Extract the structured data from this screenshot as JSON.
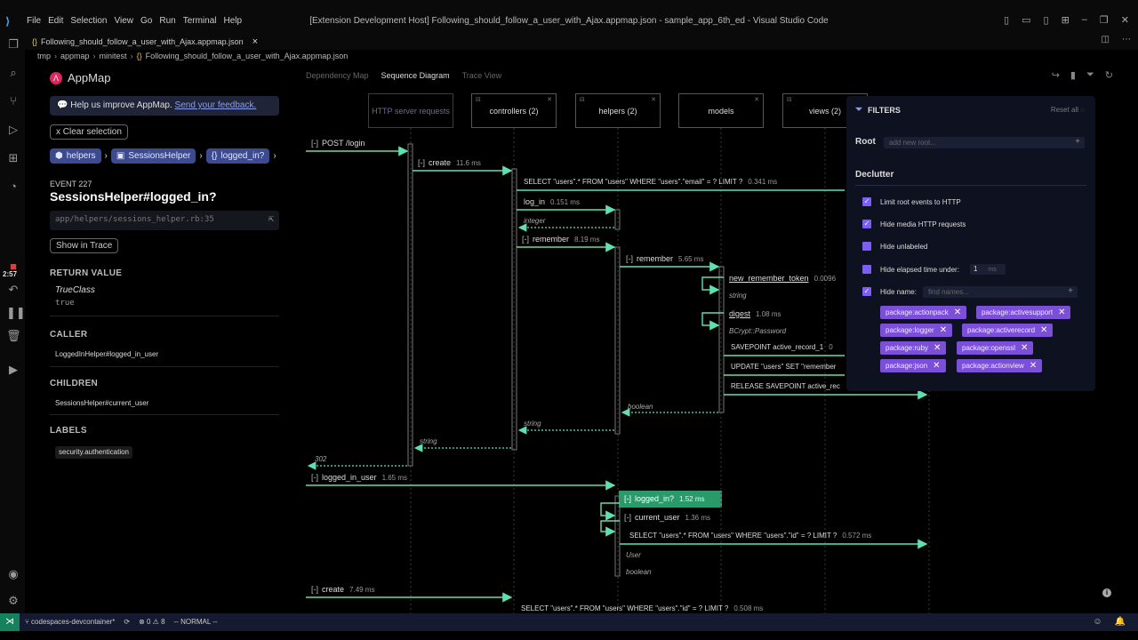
{
  "titlebar": {
    "menu": [
      "File",
      "Edit",
      "Selection",
      "View",
      "Go",
      "Run",
      "Terminal",
      "Help"
    ],
    "title": "[Extension Development Host] Following_should_follow_a_user_with_Ajax.appmap.json - sample_app_6th_ed - Visual Studio Code"
  },
  "tab": {
    "label": "Following_should_follow_a_user_with_Ajax.appmap.json",
    "icon": "json-braces-icon"
  },
  "breadcrumb": [
    "tmp",
    "appmap",
    "minitest",
    "Following_should_follow_a_user_with_Ajax.appmap.json"
  ],
  "activity": {
    "timer": "2:57"
  },
  "appmap": {
    "brand": "AppMap",
    "feedback_text": "Help us improve AppMap.",
    "feedback_link": "Send your feedback.",
    "clear_selection": "x  Clear selection",
    "crumbs": [
      "helpers",
      "SessionsHelper",
      "logged_in?"
    ],
    "event_label": "EVENT 227",
    "event_title": "SessionsHelper#logged_in?",
    "path": "app/helpers/sessions_helper.rb:35",
    "show_in_trace": "Show in Trace",
    "return_value_heading": "RETURN VALUE",
    "return_class": "TrueClass",
    "return_value": "true",
    "caller_heading": "CALLER",
    "caller": "LoggedInHelper#logged_in_user",
    "children_heading": "CHILDREN",
    "child": "SessionsHelper#current_user",
    "labels_heading": "LABELS",
    "label": "security.authentication"
  },
  "diagram": {
    "tabs": [
      "Dependency Map",
      "Sequence Diagram",
      "Trace View"
    ],
    "active_tab": "Sequence Diagram",
    "actors": [
      "HTTP server requests",
      "controllers (2)",
      "helpers (2)",
      "models",
      "views (2)"
    ],
    "messages": {
      "post_login": "POST /login",
      "create": "create",
      "create_ms": "11.6 ms",
      "sql_email": "SELECT \"users\".* FROM \"users\" WHERE \"users\".\"email\" = ? LIMIT ?",
      "sql_email_ms": "0.341 ms",
      "log_in": "log_in",
      "log_in_ms": "0.151 ms",
      "integer": "integer",
      "remember": "remember",
      "remember_ms": "8.19 ms",
      "remember2": "remember",
      "remember2_ms": "5.65 ms",
      "new_remember_token": "new_remember_token",
      "new_remember_token_ms": "0.0096",
      "string1": "string",
      "digest": "digest",
      "digest_ms": "1.08 ms",
      "bcrypt": "BCrypt::Password",
      "savepoint": "SAVEPOINT active_record_1",
      "savepoint_ms": "0",
      "update": "UPDATE \"users\" SET \"remember",
      "release": "RELEASE SAVEPOINT active_rec",
      "boolean1": "boolean",
      "string2": "string",
      "string3": "string",
      "r302": "302",
      "logged_in_user": "logged_in_user",
      "logged_in_user_ms": "1.65 ms",
      "logged_in": "logged_in?",
      "logged_in_ms": "1.52 ms",
      "current_user": "current_user",
      "current_user_ms": "1.36 ms",
      "sql_id": "SELECT \"users\".* FROM \"users\" WHERE \"users\".\"id\" = ? LIMIT ?",
      "sql_id_ms": "0.572 ms",
      "user": "User",
      "boolean2": "boolean",
      "create2": "create",
      "create2_ms": "7.49 ms",
      "sql_id2": "SELECT \"users\".* FROM \"users\" WHERE \"users\".\"id\" = ? LIMIT ?",
      "sql_id2_ms": "0.508 ms",
      "collapse": "[-]"
    }
  },
  "filters": {
    "title": "FILTERS",
    "reset": "Reset all",
    "root_label": "Root",
    "root_placeholder": "add new root...",
    "declutter_label": "Declutter",
    "options": [
      "Limit root events to HTTP",
      "Hide media HTTP requests",
      "Hide unlabeled",
      "Hide elapsed time under:",
      "Hide name:"
    ],
    "elapsed_value": "1",
    "elapsed_unit": "ms",
    "name_placeholder": "find names...",
    "packages": [
      "package:actionpack",
      "package:activesupport",
      "package:logger",
      "package:activerecord",
      "package:ruby",
      "package:openssl",
      "package:json",
      "package:actionview"
    ]
  },
  "status": {
    "remote": "codespaces-devcontainer*",
    "errors": "0",
    "warnings": "8",
    "mode": "-- NORMAL --"
  },
  "colors": {
    "arrow": "#5fe0b0",
    "accent": "#7b5ff2",
    "chip": "#3c4a8f",
    "highlight": "#2a9a6a",
    "status_bar": "#161a30"
  }
}
